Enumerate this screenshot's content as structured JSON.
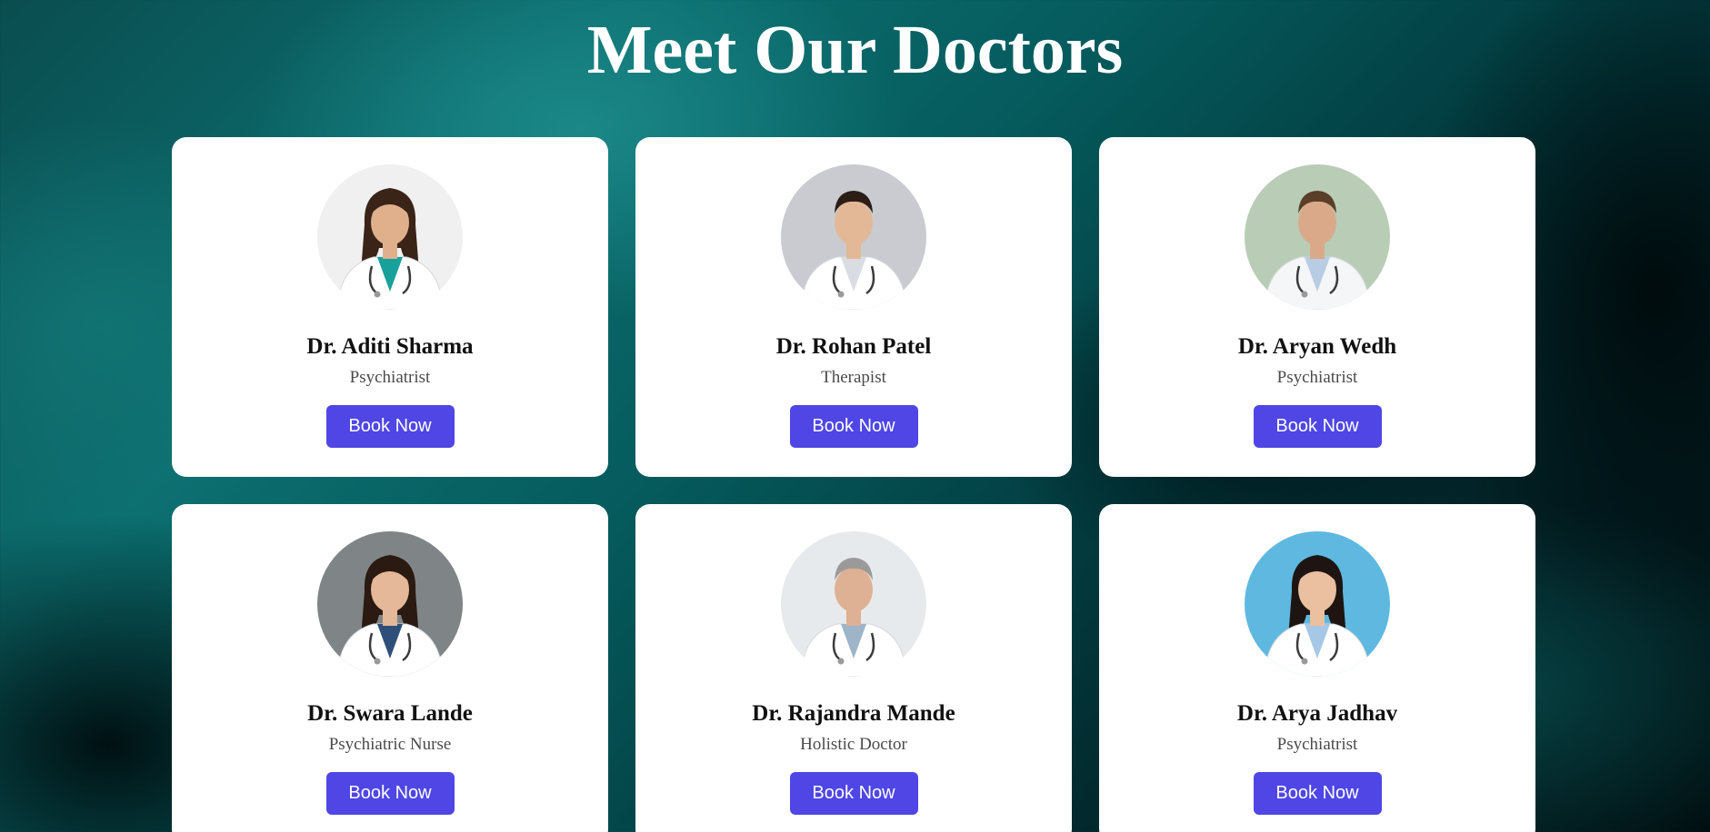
{
  "page": {
    "title": "Meet Our Doctors"
  },
  "theme": {
    "button_color": "#4f46e5",
    "card_color": "#ffffff",
    "title_color": "#ffffff"
  },
  "doctors": [
    {
      "name": "Dr. Aditi Sharma",
      "role": "Psychiatrist",
      "button_label": "Book Now",
      "avatar_icon": "doctor-photo-female",
      "photo_bg": "#f0f0f0",
      "coat": "#ffffff",
      "shirt": "#18a09a",
      "skin": "#e0b08c",
      "hair": "#3a2418"
    },
    {
      "name": "Dr. Rohan Patel",
      "role": "Therapist",
      "button_label": "Book Now",
      "avatar_icon": "doctor-photo-male",
      "photo_bg": "#c9cbd0",
      "coat": "#ffffff",
      "shirt": "#d9dde3",
      "skin": "#e2b897",
      "hair": "#2b1e16"
    },
    {
      "name": "Dr. Aryan Wedh",
      "role": "Psychiatrist",
      "button_label": "Book Now",
      "avatar_icon": "doctor-photo-male",
      "photo_bg": "#b9cdb6",
      "coat": "#f4f6f8",
      "shirt": "#b8cde4",
      "skin": "#d9a98a",
      "hair": "#5a3e28"
    },
    {
      "name": "Dr. Swara Lande",
      "role": "Psychiatric Nurse",
      "button_label": "Book Now",
      "avatar_icon": "doctor-photo-female",
      "photo_bg": "#7f8486",
      "coat": "#ffffff",
      "shirt": "#2f4f7a",
      "skin": "#e4b898",
      "hair": "#2a1a12"
    },
    {
      "name": "Dr. Rajandra Mande",
      "role": "Holistic Doctor",
      "button_label": "Book Now",
      "avatar_icon": "doctor-photo-male",
      "photo_bg": "#e7eaec",
      "coat": "#ffffff",
      "shirt": "#9eb4c8",
      "skin": "#deb094",
      "hair": "#9a9a9a"
    },
    {
      "name": "Dr. Arya Jadhav",
      "role": "Psychiatrist",
      "button_label": "Book Now",
      "avatar_icon": "doctor-photo-female",
      "photo_bg": "#5fb8e0",
      "coat": "#ffffff",
      "shirt": "#a6c8e6",
      "skin": "#eac0a0",
      "hair": "#1e1512"
    }
  ]
}
